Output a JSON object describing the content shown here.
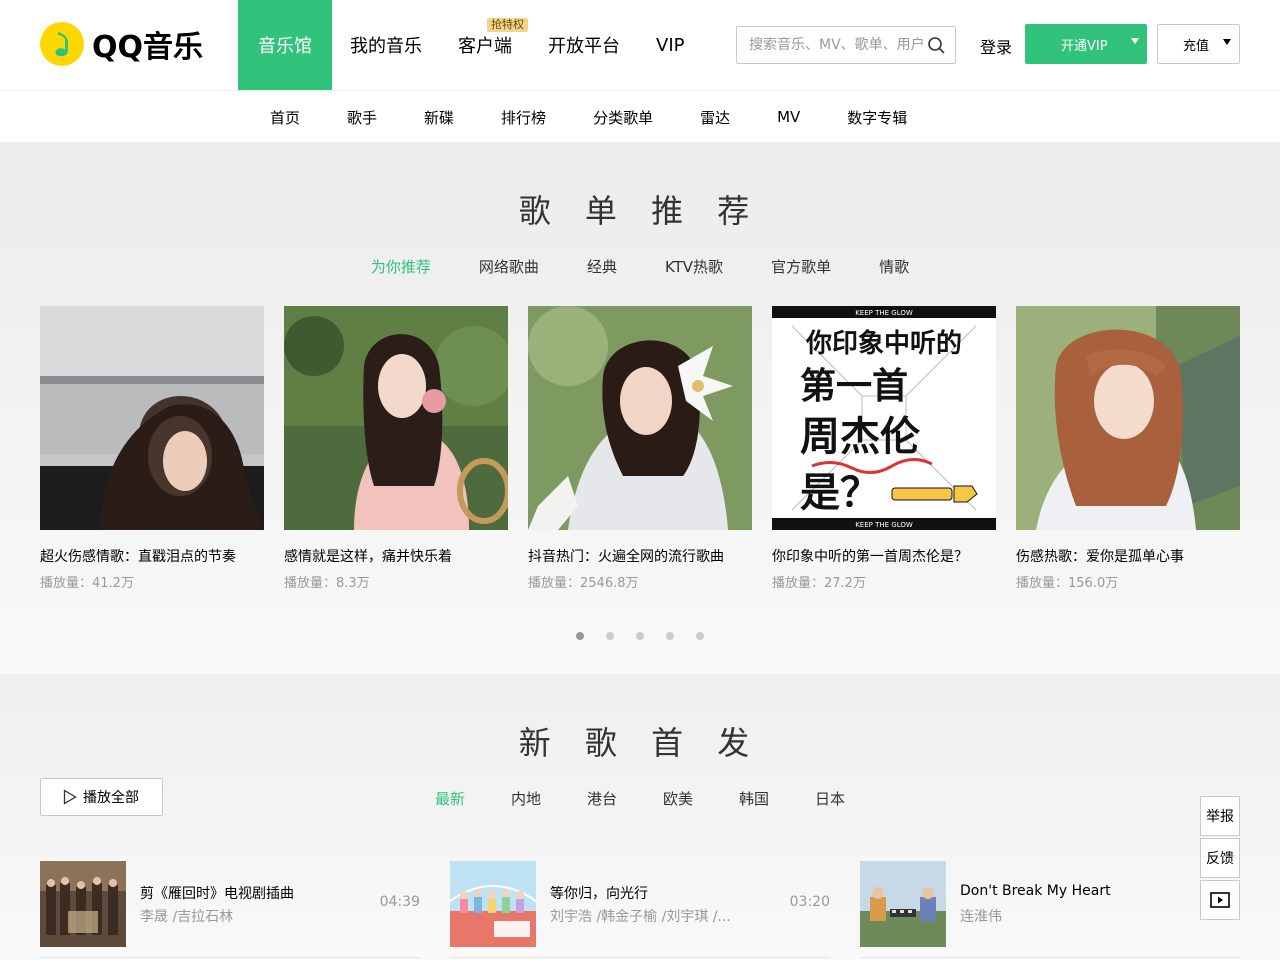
{
  "header": {
    "logo_text": "QQ音乐",
    "nav": [
      {
        "label": "音乐馆",
        "active": true
      },
      {
        "label": "我的音乐"
      },
      {
        "label": "客户端",
        "badge": "抢特权"
      },
      {
        "label": "开放平台"
      },
      {
        "label": "VIP"
      }
    ],
    "search_placeholder": "搜索音乐、MV、歌单、用户",
    "login": "登录",
    "vip_button": "开通VIP",
    "recharge_button": "充值",
    "accent_color": "#31c27c"
  },
  "subnav": [
    "首页",
    "歌手",
    "新碟",
    "排行榜",
    "分类歌单",
    "雷达",
    "MV",
    "数字专辑"
  ],
  "playlists": {
    "title": "歌 单 推 荐",
    "tabs": [
      "为你推荐",
      "网络歌曲",
      "经典",
      "KTV热歌",
      "官方歌单",
      "情歌"
    ],
    "active_tab": "为你推荐",
    "cards": [
      {
        "title": "超火伤感情歌：直戳泪点的节奏",
        "plays": "播放量：41.2万"
      },
      {
        "title": "感情就是这样，痛并快乐着",
        "plays": "播放量：8.3万"
      },
      {
        "title": "抖音热门：火遍全网的流行歌曲",
        "plays": "播放量：2546.8万"
      },
      {
        "title": "你印象中听的第一首周杰伦是？",
        "plays": "播放量：27.2万",
        "cover_text": [
          "你印象中听的",
          "第一首",
          "周杰伦",
          "是？"
        ],
        "cover_banner": "KEEP THE GLOW"
      },
      {
        "title": "伤感热歌：爱你是孤单心事",
        "plays": "播放量：156.0万"
      }
    ],
    "pages": 5,
    "current_page": 1
  },
  "new_songs": {
    "title": "新 歌 首 发",
    "play_all": "播放全部",
    "tabs": [
      "最新",
      "内地",
      "港台",
      "欧美",
      "韩国",
      "日本"
    ],
    "active_tab": "最新",
    "songs": [
      {
        "name": "剪《雁回时》电视剧插曲",
        "artist": "李晟 /吉拉石林",
        "duration": "04:39"
      },
      {
        "name": "等你归，向光行",
        "artist": "刘宇浩 /韩金子榆 /刘宇琪 /...",
        "duration": "03:20"
      },
      {
        "name": "Don't Break My Heart",
        "artist": "连淮伟",
        "duration": ""
      }
    ]
  },
  "side": {
    "report": "举报",
    "feedback": "反馈",
    "play_icon": "play-box-icon"
  }
}
